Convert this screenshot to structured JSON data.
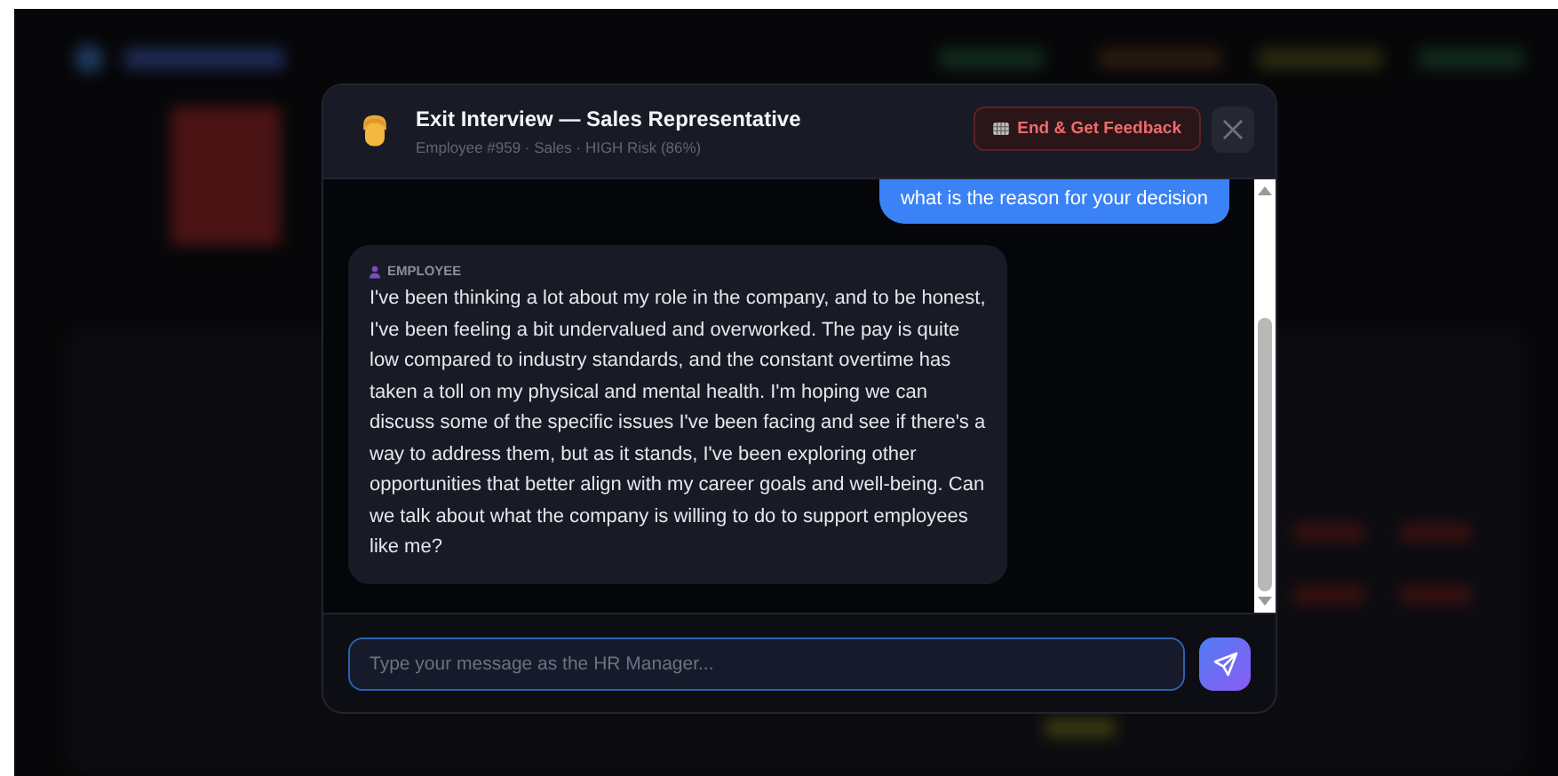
{
  "modal": {
    "title": "Exit Interview — Sales Representative",
    "subtitle": "Employee #959 · Sales · HIGH Risk (86%)",
    "end_button": "End & Get Feedback"
  },
  "messages": [
    {
      "kind": "user",
      "text": "what is the reason for your decision"
    },
    {
      "kind": "employee",
      "label": "EMPLOYEE",
      "text": "I've been thinking a lot about my role in the company, and to be honest, I've been feeling a bit undervalued and overworked. The pay is quite low compared to industry standards, and the constant overtime has taken a toll on my physical and mental health. I'm hoping we can discuss some of the specific issues I've been facing and see if there's a way to address them, but as it stands, I've been exploring other opportunities that better align with my career goals and well-being. Can we talk about what the company is willing to do to support employees like me?"
    }
  ],
  "composer": {
    "placeholder": "Type your message as the HR Manager..."
  }
}
